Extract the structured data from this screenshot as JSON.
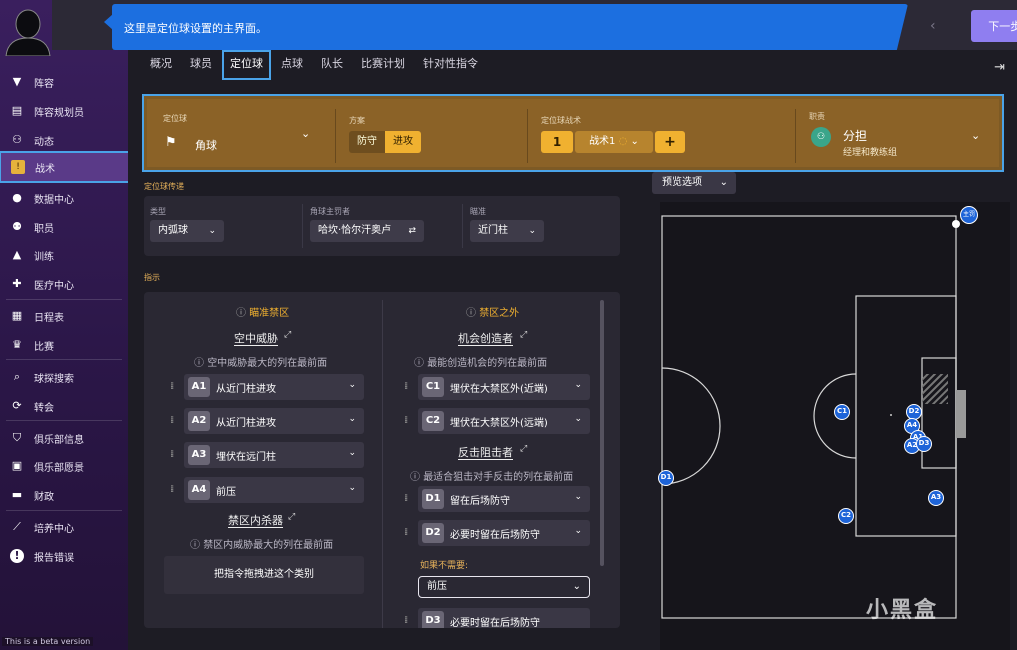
{
  "topbar": {
    "message": "这里是定位球设置的主界面。",
    "next_label": "下一步"
  },
  "sidebar": {
    "items": [
      {
        "label": "阵容",
        "icon": "shirt-icon"
      },
      {
        "label": "阵容规划员",
        "icon": "clipboard-icon"
      },
      {
        "label": "动态",
        "icon": "people-icon"
      },
      {
        "label": "战术",
        "icon": "tactics-board-icon"
      },
      {
        "label": "数据中心",
        "icon": "data-hub-icon"
      },
      {
        "label": "职员",
        "icon": "staff-icon"
      },
      {
        "label": "训练",
        "icon": "training-cone-icon"
      },
      {
        "label": "医疗中心",
        "icon": "medical-icon"
      },
      {
        "label": "日程表",
        "icon": "calendar-icon"
      },
      {
        "label": "比赛",
        "icon": "trophy-icon"
      },
      {
        "label": "球探搜索",
        "icon": "search-icon"
      },
      {
        "label": "转会",
        "icon": "transfer-icon"
      },
      {
        "label": "俱乐部信息",
        "icon": "shield-icon"
      },
      {
        "label": "俱乐部愿景",
        "icon": "briefcase-icon"
      },
      {
        "label": "财政",
        "icon": "wallet-icon"
      },
      {
        "label": "培养中心",
        "icon": "growth-icon"
      },
      {
        "label": "报告错误",
        "icon": "alert-icon"
      }
    ],
    "active_index": 3,
    "beta_text": "This is a beta version"
  },
  "tabs": [
    "概况",
    "球员",
    "定位球",
    "点球",
    "队长",
    "比赛计划",
    "针对性指令"
  ],
  "active_tab": 2,
  "control_bar": {
    "setpiece_label": "定位球",
    "setpiece_value": "角球",
    "plan_label": "方案",
    "plan_off": "防守",
    "plan_on": "进攻",
    "tactic_label": "定位球战术",
    "tactic_number": "1",
    "tactic_name": "战术1",
    "tactic_add": "+",
    "duty_label": "职责",
    "duty_value": "分担",
    "duty_sub": "经理和教练组"
  },
  "delivery": {
    "section_title": "定位球传递",
    "type_label": "类型",
    "type_value": "内弧球",
    "taker_label": "角球主罚者",
    "taker_value": "哈坎·恰尔汗奥卢",
    "aim_label": "瞄准",
    "aim_value": "近门柱"
  },
  "instructions": {
    "section_title": "指示",
    "left": {
      "header": "瞄准禁区",
      "group1_title": "空中威胁",
      "group1_note": "空中威胁最大的列在最前面",
      "slots": [
        {
          "tag": "A1",
          "text": "从近门柱进攻"
        },
        {
          "tag": "A2",
          "text": "从近门柱进攻"
        },
        {
          "tag": "A3",
          "text": "埋伏在远门柱"
        },
        {
          "tag": "A4",
          "text": "前压"
        }
      ],
      "group2_title": "禁区内杀器",
      "group2_note": "禁区内威胁最大的列在最前面",
      "drop_hint": "把指令拖拽进这个类别"
    },
    "right": {
      "header": "禁区之外",
      "group1_title": "机会创造者",
      "group1_note": "最能创造机会的列在最前面",
      "slots_c": [
        {
          "tag": "C1",
          "text": "埋伏在大禁区外(近端)"
        },
        {
          "tag": "C2",
          "text": "埋伏在大禁区外(远端)"
        }
      ],
      "group2_title": "反击阻击者",
      "group2_note": "最适合狙击对手反击的列在最前面",
      "slots_d": [
        {
          "tag": "D1",
          "text": "留在后场防守"
        },
        {
          "tag": "D2",
          "text": "必要时留在后场防守"
        }
      ],
      "if_not_needed": "如果不需要:",
      "fallback_value": "前压",
      "slot_d3": {
        "tag": "D3",
        "text": "必要时留在后场防守"
      }
    }
  },
  "preview": {
    "options_label": "预览选项",
    "taker_badge": "主罚",
    "markers": [
      "D2",
      "A4",
      "A1",
      "A2",
      "D3",
      "C1",
      "A3",
      "C2",
      "D1"
    ]
  },
  "watermark": "小黑盒"
}
